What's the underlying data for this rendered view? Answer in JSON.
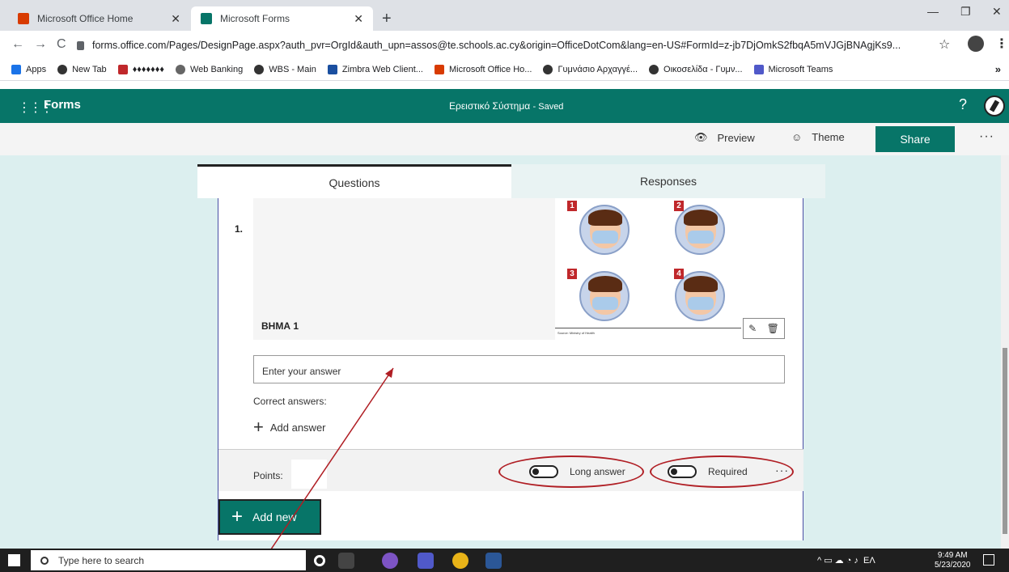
{
  "browser": {
    "tabs": [
      {
        "title": "Microsoft Office Home",
        "icon_color": "#d83b01"
      },
      {
        "title": "Microsoft Forms",
        "icon_color": "#077568"
      }
    ],
    "url": "forms.office.com/Pages/DesignPage.aspx?auth_pvr=OrgId&auth_upn=assos@te.schools.ac.cy&origin=OfficeDotCom&lang=en-US#FormId=z-jb7DjOmkS2fbqA5mVJGjBNAgjKs9...",
    "bookmarks": [
      "Apps",
      "New Tab",
      "♦♦♦♦♦♦♦",
      "Web Banking",
      "WBS - Main",
      "Zimbra Web Client...",
      "Microsoft Office Ho...",
      "Γυμνάσιο Αρχαγγέ...",
      "Οικοσελίδα - Γυμν...",
      "Microsoft Teams"
    ]
  },
  "forms": {
    "app_name": "Forms",
    "form_title": "Ερειστικό Σύστημα",
    "saved_status": "- Saved",
    "help": "?",
    "toolbar": {
      "preview": "Preview",
      "theme": "Theme",
      "share": "Share",
      "more": "···"
    },
    "tabs": {
      "questions": "Questions",
      "responses": "Responses"
    },
    "brand_color": "#077568"
  },
  "question": {
    "number": "1.",
    "title": "ΒΗΜΑ 1",
    "image_steps": [
      "1",
      "2",
      "3",
      "4"
    ],
    "image_source": "Source: Ministry of Health",
    "answer_placeholder": "Enter your answer",
    "correct_answers_label": "Correct answers:",
    "add_answer": "Add answer",
    "points_label": "Points:",
    "long_answer": "Long answer",
    "required": "Required",
    "more": "···"
  },
  "add_new": "Add new",
  "taskbar": {
    "search_placeholder": "Type here to search",
    "lang": "ΕΛ",
    "time": "9:49 AM",
    "date": "5/23/2020"
  }
}
